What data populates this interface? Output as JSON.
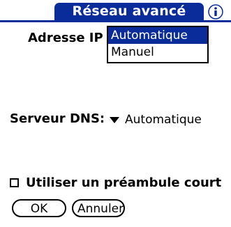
{
  "dialog": {
    "title": "Réseau avancé",
    "info_icon": "info-icon"
  },
  "ip": {
    "label": "Adresse IP",
    "options": [
      "Automatique",
      "Manuel"
    ],
    "selected": "Automatique"
  },
  "dns": {
    "label": "Serveur DNS:",
    "value": "Automatique",
    "arrow_icon": "triangle-down-icon"
  },
  "preamble": {
    "label": "Utiliser un préambule court",
    "checked": false
  },
  "buttons": {
    "ok": "OK",
    "cancel": "Annuler"
  },
  "colors": {
    "accent": "#0a2c9a"
  }
}
